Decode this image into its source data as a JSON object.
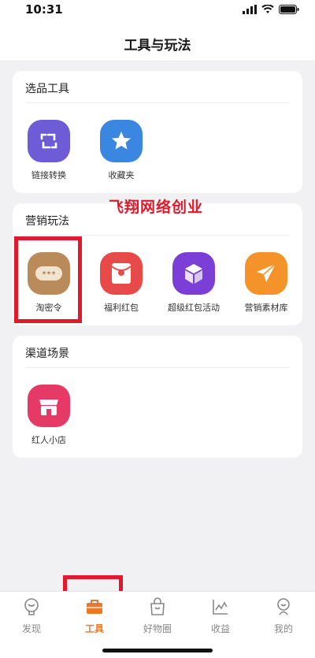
{
  "status_bar": {
    "time": "10:31"
  },
  "nav": {
    "title": "工具与玩法"
  },
  "watermark": "飞翔网络创业",
  "sections": [
    {
      "title": "选品工具",
      "items": [
        {
          "label": "链接转换",
          "icon": "link-convert-icon",
          "color": "#6e5bd6"
        },
        {
          "label": "收藏夹",
          "icon": "star-icon",
          "color": "#3a86e0"
        }
      ]
    },
    {
      "title": "营销玩法",
      "items": [
        {
          "label": "淘密令",
          "icon": "password-icon",
          "color": "#b98a5a"
        },
        {
          "label": "福利红包",
          "icon": "red-envelope-icon",
          "color": "#e84a4a"
        },
        {
          "label": "超级红包活动",
          "icon": "cube-icon",
          "color": "#7b3fd8"
        },
        {
          "label": "营销素材库",
          "icon": "paper-plane-icon",
          "color": "#f4932a"
        }
      ]
    },
    {
      "title": "渠道场景",
      "items": [
        {
          "label": "红人小店",
          "icon": "shop-icon",
          "color": "#e63a66"
        }
      ]
    }
  ],
  "tabs": [
    {
      "label": "发现",
      "icon": "discover-icon"
    },
    {
      "label": "工具",
      "icon": "toolbox-icon",
      "active": true
    },
    {
      "label": "好物圈",
      "icon": "shopping-bag-icon"
    },
    {
      "label": "收益",
      "icon": "chart-icon"
    },
    {
      "label": "我的",
      "icon": "profile-icon"
    }
  ],
  "colors": {
    "accent": "#e8782a",
    "highlight": "#e01a2c",
    "watermark": "#e0182a"
  }
}
